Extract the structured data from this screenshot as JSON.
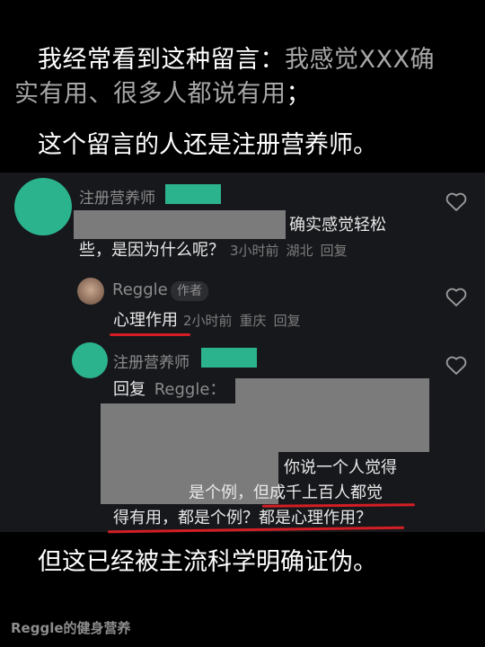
{
  "captions": {
    "top_line1": "我经常看到这种留言：",
    "top_line1_quote": "我感觉XXX确",
    "top_line2_quote": "实有用、很多人都说有用",
    "top_line2_end": "；",
    "sub": "这个留言的人还是注册营养师。",
    "bottom": "但这已经被主流科学明确证伪。"
  },
  "comments": {
    "c1": {
      "name": "注册营养师",
      "text_end": "确实感觉轻松",
      "text_line2": "些，是因为什么呢？",
      "time": "3小时前",
      "location": "湖北",
      "reply": "回复"
    },
    "c2": {
      "name": "Reggle",
      "tag": "作者",
      "text": "心理作用",
      "time": "2小时前",
      "location": "重庆",
      "reply": "回复"
    },
    "c3": {
      "name": "注册营养师",
      "reply_prefix": "回复",
      "reply_to": "Reggle：",
      "line1": "你说一个人觉得",
      "line2a": "是个例，",
      "line2b": "但成千上百人都觉",
      "line3": "得有用，都是个例？都是心理作用？"
    }
  },
  "icons": {
    "like": "heart-outline-icon"
  },
  "colors": {
    "accent_green": "#2bb38e",
    "underline_red": "#d21e24",
    "redaction_gray": "#7b7b7b"
  },
  "watermark": "Reggle的健身营养"
}
